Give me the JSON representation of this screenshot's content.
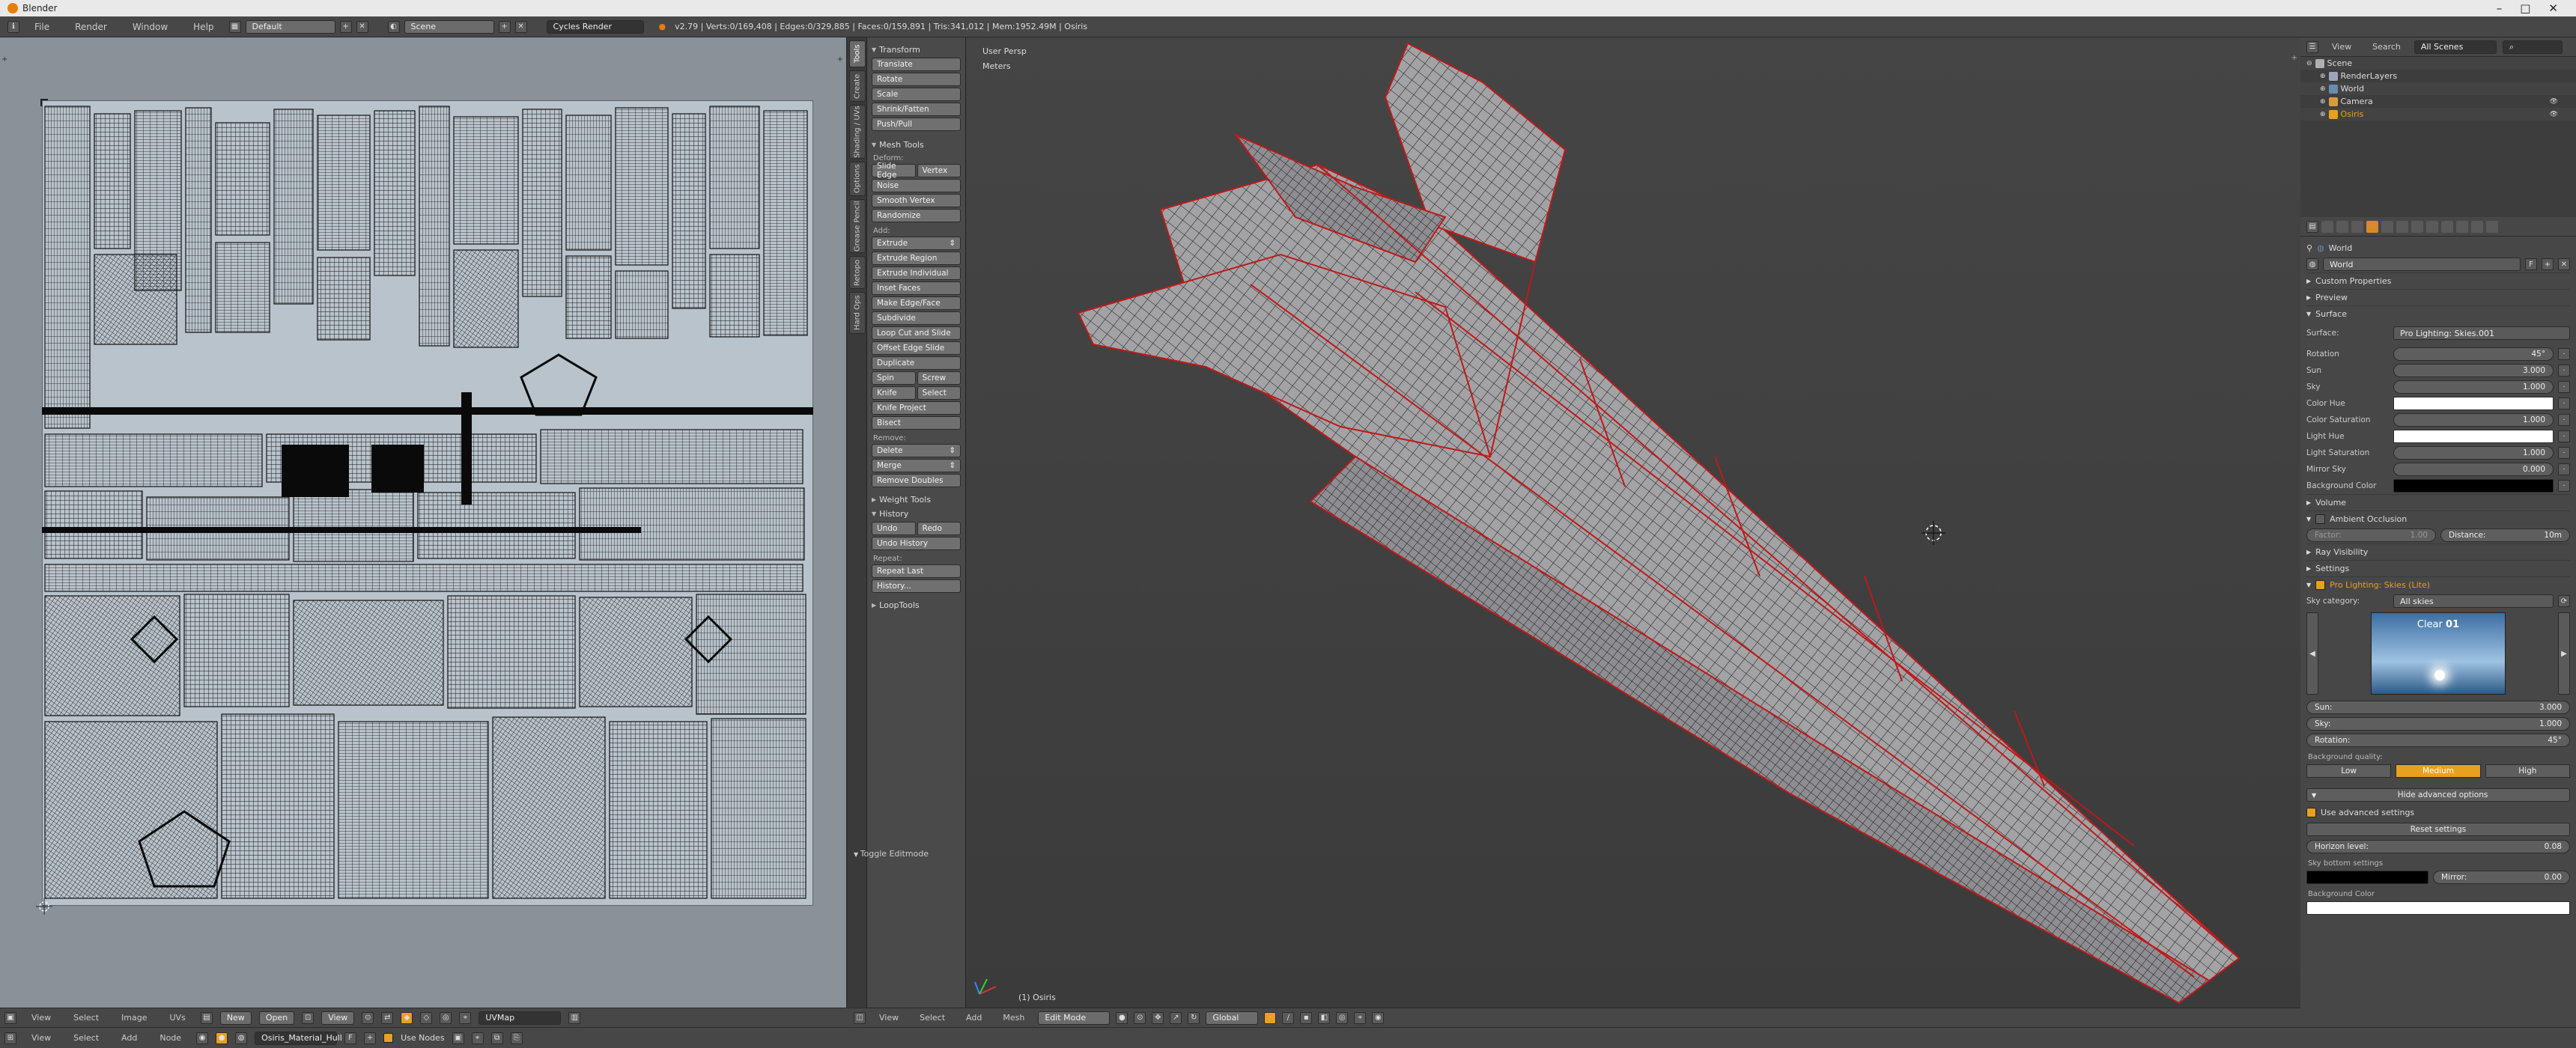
{
  "window": {
    "title": "Blender"
  },
  "topbar": {
    "menus": [
      "File",
      "Render",
      "Window",
      "Help"
    ],
    "layout": "Default",
    "scene": "Scene",
    "engine": "Cycles Render",
    "stats": "v2.79 | Verts:0/169,408 | Edges:0/329,885 | Faces:0/159,891 | Tris:341,012 | Mem:1952.49M | Osiris"
  },
  "uv_editor": {
    "menus": [
      "View",
      "Select",
      "Image",
      "UVs"
    ],
    "new_label": "New",
    "open_label": "Open",
    "view_label": "View",
    "uvmap": "UVMap"
  },
  "node_header": {
    "menus": [
      "View",
      "Select",
      "Add",
      "Node"
    ],
    "material": "Osiris_Material_Hull",
    "use_nodes": "Use Nodes"
  },
  "toolshelf": {
    "tabs": [
      "Tools",
      "Create",
      "Shading / UVs",
      "Options",
      "Grease Pencil",
      "Retopo",
      "Hard Ops"
    ],
    "transform_title": "Transform",
    "transform": [
      "Translate",
      "Rotate",
      "Scale",
      "Shrink/Fatten",
      "Push/Pull"
    ],
    "mesh_tools_title": "Mesh Tools",
    "deform_label": "Deform:",
    "slide_edge": "Slide Edge",
    "vertex": "Vertex",
    "deform": [
      "Noise",
      "Smooth Vertex",
      "Randomize"
    ],
    "add_label": "Add:",
    "extrude": "Extrude",
    "add": [
      "Extrude Region",
      "Extrude Individual",
      "Inset Faces",
      "Make Edge/Face",
      "Subdivide",
      "Loop Cut and Slide",
      "Offset Edge Slide",
      "Duplicate"
    ],
    "spin": "Spin",
    "screw": "Screw",
    "knife": "Knife",
    "select": "Select",
    "knife_project": "Knife Project",
    "bisect": "Bisect",
    "remove_label": "Remove:",
    "delete": "Delete",
    "merge": "Merge",
    "remove_doubles": "Remove Doubles",
    "weight_tools": "Weight Tools",
    "history_title": "History",
    "undo": "Undo",
    "redo": "Redo",
    "undo_history": "Undo History",
    "repeat_label": "Repeat:",
    "repeat_last": "Repeat Last",
    "history": "History...",
    "looptools": "LoopTools",
    "toggle_editmode": "Toggle Editmode"
  },
  "viewport": {
    "view_name": "User Persp",
    "units": "Meters",
    "object_label": "(1) Osiris",
    "menus": [
      "View",
      "Select",
      "Add",
      "Mesh"
    ],
    "mode": "Edit Mode",
    "orientation": "Global"
  },
  "outliner": {
    "menus": [
      "View",
      "Search"
    ],
    "scenes": "All Scenes",
    "items": [
      {
        "name": "Scene",
        "indent": 0,
        "color": "#b0b0b0"
      },
      {
        "name": "RenderLayers",
        "indent": 1,
        "color": "#9aa6b8"
      },
      {
        "name": "World",
        "indent": 1,
        "color": "#6a8bb0"
      },
      {
        "name": "Camera",
        "indent": 1,
        "color": "#d89a3a"
      },
      {
        "name": "Osiris",
        "indent": 1,
        "color": "#e8a020"
      }
    ]
  },
  "properties": {
    "context": "World",
    "world_name": "World",
    "fake_user": "F",
    "custom_properties": "Custom Properties",
    "preview": "Preview",
    "surface": "Surface",
    "surface_label": "Surface:",
    "surface_value": "Pro Lighting: Skies.001",
    "params": [
      {
        "label": "Rotation",
        "value": "45°"
      },
      {
        "label": "Sun",
        "value": "3.000"
      },
      {
        "label": "Sky",
        "value": "1.000"
      },
      {
        "label": "Color Hue",
        "value": "",
        "color": "#ffffff"
      },
      {
        "label": "Color Saturation",
        "value": "1.000"
      },
      {
        "label": "Light Hue",
        "value": "",
        "color": "#ffffff"
      },
      {
        "label": "Light Saturation",
        "value": "1.000"
      },
      {
        "label": "Mirror Sky",
        "value": "0.000"
      },
      {
        "label": "Background Color",
        "value": "",
        "color": "#000000"
      }
    ],
    "volume": "Volume",
    "ambient_occlusion": "Ambient Occlusion",
    "ao_factor_label": "Factor:",
    "ao_factor": "1.00",
    "ao_distance_label": "Distance:",
    "ao_distance": "10m",
    "ray_visibility": "Ray Visibility",
    "settings": "Settings",
    "pro_lighting": "Pro Lighting: Skies (Lite)",
    "sky_category_label": "Sky category:",
    "sky_category": "All skies",
    "preview_name": "Clear",
    "preview_number": "01",
    "sky_params": [
      {
        "label": "Sun:",
        "value": "3.000"
      },
      {
        "label": "Sky:",
        "value": "1.000"
      },
      {
        "label": "Rotation:",
        "value": "45°"
      }
    ],
    "bg_quality_label": "Background quality:",
    "quality": [
      "Low",
      "Medium",
      "High"
    ],
    "quality_selected": "Medium",
    "hide_advanced": "Hide advanced options",
    "use_advanced": "Use advanced settings",
    "reset": "Reset settings",
    "horizon_label": "Horizon level:",
    "horizon": "0.08",
    "sky_bottom": "Sky bottom settings",
    "mirror_label": "Mirror:",
    "mirror": "0.00",
    "bg_color_label": "Background Color",
    "accent": "#e8a020"
  }
}
